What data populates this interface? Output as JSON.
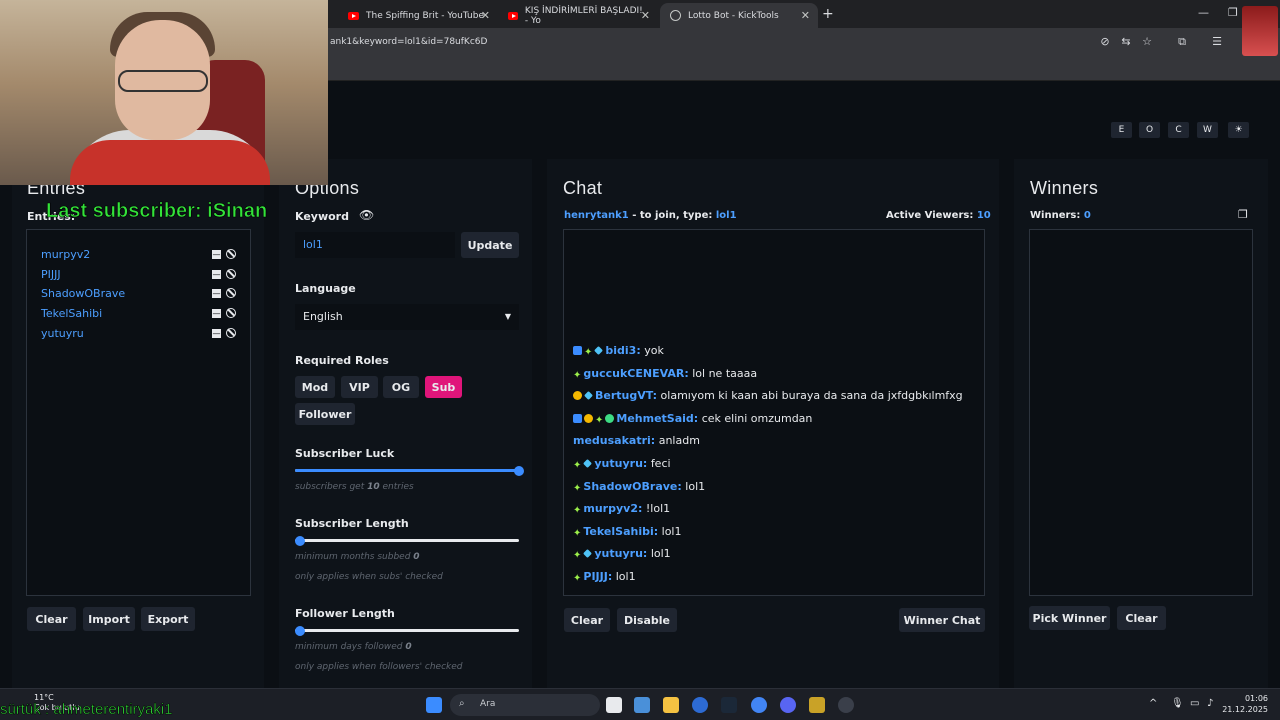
{
  "browser": {
    "tabs": [
      {
        "title": "The Spiffing Brit - YouTube",
        "icon": "youtube-icon"
      },
      {
        "title": "KIŞ İNDİRİMLERİ BAŞLADI! - Yo",
        "icon": "youtube-icon"
      },
      {
        "title": "Lotto Bot - KickTools",
        "icon": "globe-icon",
        "active": true
      }
    ],
    "url": "ank1&keyword=lol1&id=78ufKc6D"
  },
  "theme_buttons": [
    "E",
    "O",
    "C",
    "W",
    "☀"
  ],
  "entries": {
    "title": "Entries",
    "label": "Entries:",
    "items": [
      "murpyv2",
      "PIJJJ",
      "ShadowOBrave",
      "TekelSahibi",
      "yutuyru"
    ],
    "buttons": {
      "clear": "Clear",
      "import": "Import",
      "export": "Export"
    }
  },
  "options": {
    "title": "Options",
    "keyword_label": "Keyword",
    "keyword_value": "lol1",
    "update_button": "Update",
    "language_label": "Language",
    "language_value": "English",
    "roles_label": "Required Roles",
    "roles": [
      {
        "label": "Mod",
        "active": false
      },
      {
        "label": "VIP",
        "active": false
      },
      {
        "label": "OG",
        "active": false
      },
      {
        "label": "Sub",
        "active": true
      },
      {
        "label": "Follower",
        "active": false
      }
    ],
    "sub_luck_label": "Subscriber Luck",
    "sub_luck_value": 1.0,
    "sub_luck_hint_pre": "subscribers get",
    "sub_luck_hint_num": "10",
    "sub_luck_hint_post": "entries",
    "sub_length_label": "Subscriber Length",
    "sub_length_value": 0,
    "sub_length_hint_pre": "minimum months subbed",
    "sub_length_hint_num": "0",
    "sub_length_hint2": "only applies when subs' checked",
    "follow_length_label": "Follower Length",
    "follow_length_value": 0,
    "follow_length_hint_pre": "minimum days followed",
    "follow_length_hint_num": "0",
    "follow_length_hint2": "only applies when followers' checked"
  },
  "chat": {
    "title": "Chat",
    "streamer": "henrytank1",
    "join_text": "- to join, type:",
    "keyword": "lol1",
    "viewers_label": "Active Viewers:",
    "viewers_count": "10",
    "messages": [
      {
        "badges": [
          "verified",
          "sub",
          "gem"
        ],
        "user": "bidi3:",
        "text": "yok"
      },
      {
        "badges": [
          "sub"
        ],
        "user": "guccukCENEVAR:",
        "text": "lol ne taaaa"
      },
      {
        "badges": [
          "gift",
          "gem"
        ],
        "user": "BertugVT:",
        "text": "olamıyom ki kaan abi buraya da sana da jxfdgbkılmfxg"
      },
      {
        "badges": [
          "verified",
          "gift",
          "sub",
          "green"
        ],
        "user": "MehmetSaid:",
        "text": "cek elini omzumdan"
      },
      {
        "badges": [],
        "user": "medusakatri:",
        "text": "anladm"
      },
      {
        "badges": [
          "sub",
          "gem"
        ],
        "user": "yutuyru:",
        "text": "feci"
      },
      {
        "badges": [
          "sub"
        ],
        "user": "ShadowOBrave:",
        "text": "lol1"
      },
      {
        "badges": [
          "sub"
        ],
        "user": "murpyv2:",
        "text": "!lol1"
      },
      {
        "badges": [
          "sub"
        ],
        "user": "TekelSahibi:",
        "text": "lol1"
      },
      {
        "badges": [
          "sub",
          "gem"
        ],
        "user": "yutuyru:",
        "text": "lol1"
      },
      {
        "badges": [
          "sub"
        ],
        "user": "PIJJJ:",
        "text": "lol1"
      }
    ],
    "buttons": {
      "clear": "Clear",
      "disable": "Disable",
      "winner_chat": "Winner Chat"
    }
  },
  "winners": {
    "title": "Winners",
    "label": "Winners:",
    "count": "0",
    "buttons": {
      "pick": "Pick Winner",
      "clear": "Clear"
    }
  },
  "overlay": {
    "last_subscriber": "Last subscriber: iSinan",
    "follower_ticker": "sürtük : ahmeterentiryaki1"
  },
  "taskbar": {
    "weather_temp": "11°C",
    "weather_desc": "Çok bulutlu",
    "search_placeholder": "Ara",
    "time": "01:06",
    "date": "21.12.2025"
  },
  "colors": {
    "accent": "#4d9fff",
    "sub_active": "#e0157a",
    "panel": "#0e1319",
    "bg": "#0b0f14"
  }
}
